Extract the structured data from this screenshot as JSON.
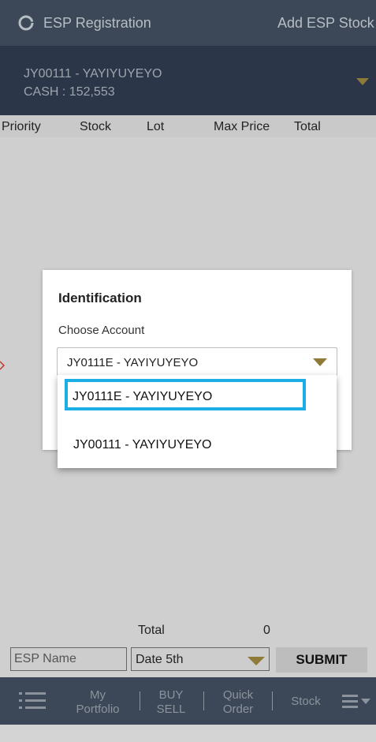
{
  "header": {
    "title": "ESP Registration",
    "action_label": "Add ESP Stock",
    "refresh_icon": "refresh-icon"
  },
  "account_bar": {
    "account": "JY00111 - YAYIYUYEYO",
    "cash": "CASH : 152,553"
  },
  "table": {
    "columns": [
      "Priority",
      "Stock",
      "Lot",
      "Max Price",
      "Total"
    ]
  },
  "dialog": {
    "title": "Identification",
    "label": "Choose Account",
    "selected": "JY0111E - YAYIYUYEYO",
    "options": [
      "JY0111E - YAYIYUYEYO",
      "JY00111 - YAYIYUYEYO"
    ]
  },
  "totals": {
    "label": "Total",
    "value": "0"
  },
  "form": {
    "esp_name_placeholder": "ESP Name",
    "date_value": "Date 5th",
    "submit_label": "SUBMIT"
  },
  "bottom_nav": {
    "items": [
      {
        "line1": "My",
        "line2": "Portfolio"
      },
      {
        "line1": "BUY",
        "line2": "SELL"
      },
      {
        "line1": "Quick",
        "line2": "Order"
      },
      {
        "line1": "Stock",
        "line2": ""
      }
    ]
  },
  "colors": {
    "header_bg": "#3c4858",
    "account_bg": "#2b3648",
    "accent_gold": "#8f7a38",
    "highlight": "#1aaee5"
  }
}
